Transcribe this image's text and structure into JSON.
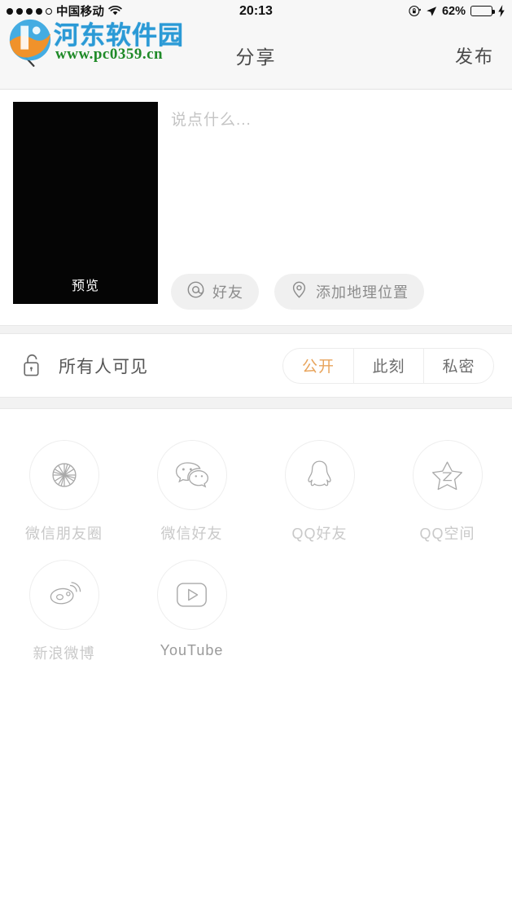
{
  "status_bar": {
    "signal_dots_total": 5,
    "signal_dots_filled": 4,
    "carrier": "中国移动",
    "wifi_icon": "wifi-icon",
    "time": "20:13",
    "rotation_lock_icon": "rotation-lock-icon",
    "location_icon": "location-arrow-icon",
    "battery_percent": "62%",
    "battery_level": 62,
    "battery_color": "#27cc3e",
    "charging_icon": "lightning-bolt-icon"
  },
  "nav_bar": {
    "back_icon": "chevron-left-icon",
    "title": "分享",
    "action_label": "发布"
  },
  "watermark": {
    "site_name": "河东软件园",
    "url": "www.pc0359.cn",
    "logo_icon": "pc0359-logo-icon",
    "name_color": "#2b9ad6",
    "url_color": "#1f8a28"
  },
  "compose": {
    "thumbnail_label": "预览",
    "thumbnail_color": "#050505",
    "note_placeholder": "说点什么...",
    "note_value": "",
    "pills": [
      {
        "icon": "at-mention-icon",
        "label": "好友"
      },
      {
        "icon": "location-pin-icon",
        "label": "添加地理位置"
      }
    ]
  },
  "privacy": {
    "lock_icon": "unlock-icon",
    "label": "所有人可见",
    "options": [
      {
        "label": "公开",
        "selected": true
      },
      {
        "label": "此刻",
        "selected": false
      },
      {
        "label": "私密",
        "selected": false
      }
    ],
    "selected_color": "#e8a45c"
  },
  "share": {
    "row1": [
      {
        "icon": "wechat-moments-icon",
        "label": "微信朋友圈"
      },
      {
        "icon": "wechat-friends-icon",
        "label": "微信好友"
      },
      {
        "icon": "qq-penguin-icon",
        "label": "QQ好友"
      },
      {
        "icon": "qzone-star-icon",
        "label": "QQ空间"
      }
    ],
    "row2": [
      {
        "icon": "sina-weibo-icon",
        "label": "新浪微博"
      },
      {
        "icon": "youtube-icon",
        "label": "YouTube"
      }
    ]
  }
}
